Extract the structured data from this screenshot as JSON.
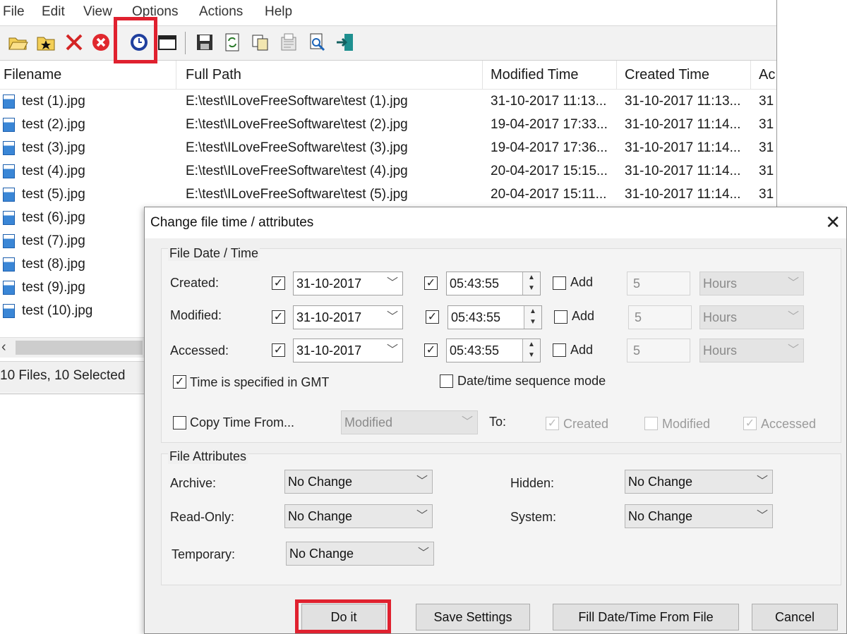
{
  "menu": [
    "File",
    "Edit",
    "View",
    "Options",
    "Actions",
    "Help"
  ],
  "toolbar": {
    "icons": [
      "open-folder-icon",
      "favorite-folder-icon",
      "delete-x-icon",
      "stop-icon",
      "clock-icon",
      "window-icon",
      "save-icon",
      "refresh-icon",
      "copy-icon",
      "properties-icon",
      "find-icon",
      "exit-icon"
    ]
  },
  "list": {
    "columns": [
      "Filename",
      "Full Path",
      "Modified Time",
      "Created Time",
      "Ac"
    ],
    "rows": [
      {
        "name": "test (1).jpg",
        "path": "E:\\test\\ILoveFreeSoftware\\test (1).jpg",
        "modified": "31-10-2017 11:13...",
        "created": "31-10-2017 11:13...",
        "accessed": "31"
      },
      {
        "name": "test (2).jpg",
        "path": "E:\\test\\ILoveFreeSoftware\\test (2).jpg",
        "modified": "19-04-2017 17:33...",
        "created": "31-10-2017 11:14...",
        "accessed": "31"
      },
      {
        "name": "test (3).jpg",
        "path": "E:\\test\\ILoveFreeSoftware\\test (3).jpg",
        "modified": "19-04-2017 17:36...",
        "created": "31-10-2017 11:14...",
        "accessed": "31"
      },
      {
        "name": "test (4).jpg",
        "path": "E:\\test\\ILoveFreeSoftware\\test (4).jpg",
        "modified": "20-04-2017 15:15...",
        "created": "31-10-2017 11:14...",
        "accessed": "31"
      },
      {
        "name": "test (5).jpg",
        "path": "E:\\test\\ILoveFreeSoftware\\test (5).jpg",
        "modified": "20-04-2017 15:11...",
        "created": "31-10-2017 11:14...",
        "accessed": "31"
      },
      {
        "name": "test (6).jpg"
      },
      {
        "name": "test (7).jpg"
      },
      {
        "name": "test (8).jpg"
      },
      {
        "name": "test (9).jpg"
      },
      {
        "name": "test (10).jpg"
      }
    ]
  },
  "status": "10 Files, 10 Selected",
  "dialog": {
    "title": "Change file time / attributes",
    "close": "✕",
    "date_group": "File Date / Time",
    "created_label": "Created:",
    "modified_label": "Modified:",
    "accessed_label": "Accessed:",
    "date_value": "31-10-2017",
    "time_value": "05:43:55",
    "add_label": "Add",
    "add_amount": "5",
    "add_unit": "Hours",
    "gmt_label": "Time is specified in GMT",
    "sequence_label": "Date/time sequence mode",
    "copy_from_label": "Copy Time From...",
    "copy_from_value": "Modified",
    "to_label": "To:",
    "to_created": "Created",
    "to_modified": "Modified",
    "to_accessed": "Accessed",
    "attr_group": "File Attributes",
    "archive_label": "Archive:",
    "readonly_label": "Read-Only:",
    "temporary_label": "Temporary:",
    "hidden_label": "Hidden:",
    "system_label": "System:",
    "attr_value": "No Change",
    "buttons": {
      "do_it": "Do it",
      "save_settings": "Save Settings",
      "fill": "Fill Date/Time From File",
      "cancel": "Cancel"
    }
  },
  "colors": {
    "highlight": "#e0212f",
    "clock_icon": "#1f3f9e"
  }
}
